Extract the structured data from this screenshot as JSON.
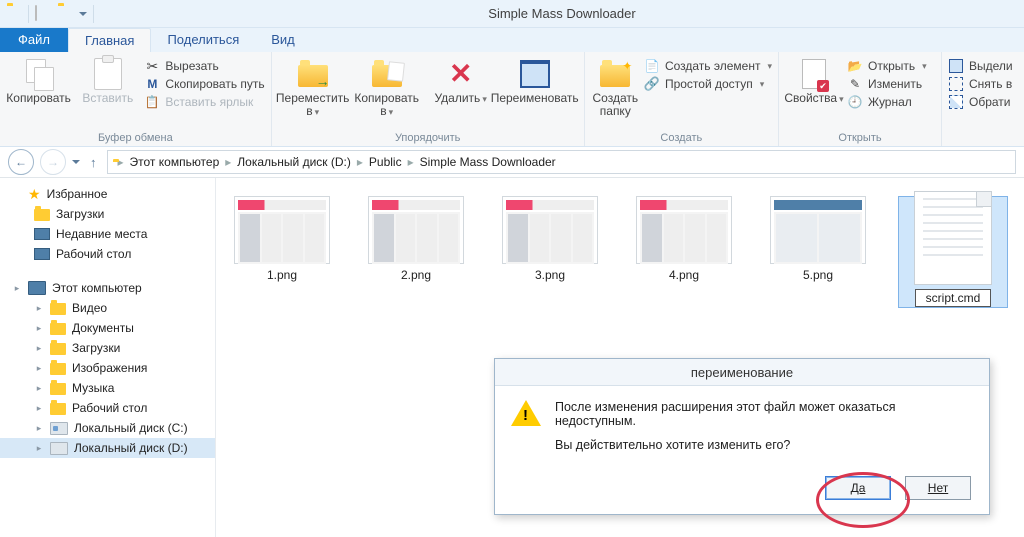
{
  "window": {
    "title": "Simple Mass Downloader"
  },
  "tabs": {
    "file": "Файл",
    "home": "Главная",
    "share": "Поделиться",
    "view": "Вид"
  },
  "ribbon": {
    "clipboard": {
      "copy": "Копировать",
      "paste": "Вставить",
      "cut": "Вырезать",
      "copy_path": "Скопировать путь",
      "paste_shortcut": "Вставить ярлык",
      "caption": "Буфер обмена"
    },
    "organize": {
      "move_to": "Переместить в",
      "copy_to": "Копировать в",
      "delete": "Удалить",
      "rename": "Переименовать",
      "caption": "Упорядочить"
    },
    "new": {
      "new_folder": "Создать папку",
      "new_item": "Создать элемент",
      "easy_access": "Простой доступ",
      "caption": "Создать"
    },
    "open": {
      "properties": "Свойства",
      "open": "Открыть",
      "edit": "Изменить",
      "history": "Журнал",
      "caption": "Открыть"
    },
    "select": {
      "select_all": "Выдели",
      "select_none": "Снять в",
      "invert": "Обрати",
      "caption": ""
    }
  },
  "breadcrumbs": [
    "Этот компьютер",
    "Локальный диск (D:)",
    "Public",
    "Simple Mass Downloader"
  ],
  "sidebar": {
    "favorites": {
      "label": "Избранное",
      "items": [
        "Загрузки",
        "Недавние места",
        "Рабочий стол"
      ]
    },
    "computer": {
      "label": "Этот компьютер",
      "items": [
        "Видео",
        "Документы",
        "Загрузки",
        "Изображения",
        "Музыка",
        "Рабочий стол",
        "Локальный диск (C:)",
        "Локальный диск (D:)"
      ]
    }
  },
  "files": [
    {
      "name": "1.png",
      "kind": "thumb"
    },
    {
      "name": "2.png",
      "kind": "thumb"
    },
    {
      "name": "3.png",
      "kind": "thumb"
    },
    {
      "name": "4.png",
      "kind": "thumb"
    },
    {
      "name": "5.png",
      "kind": "wide"
    },
    {
      "name": "script.cmd",
      "kind": "doc",
      "selected": true
    }
  ],
  "dialog": {
    "title": "переименование",
    "line1": "После изменения расширения этот файл может оказаться недоступным.",
    "line2": "Вы действительно хотите изменить его?",
    "yes": "Да",
    "no": "Нет"
  }
}
